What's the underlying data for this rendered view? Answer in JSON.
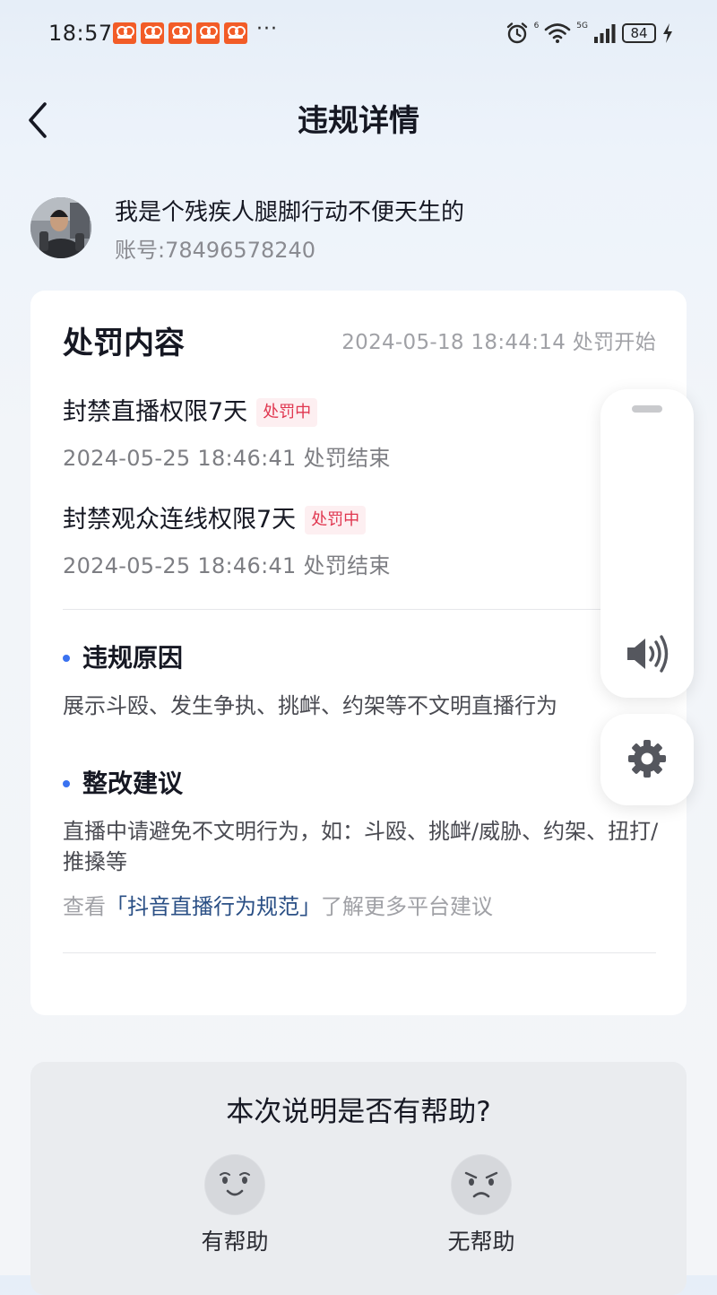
{
  "status_bar": {
    "time": "18:57",
    "more": "···",
    "battery_level": "84",
    "network": "5G",
    "signal_tag": "6"
  },
  "header": {
    "title": "违规详情"
  },
  "user": {
    "name": "我是个残疾人腿脚行动不便天生的",
    "account": "账号:78496578240"
  },
  "penalty": {
    "title": "处罚内容",
    "start": "2024-05-18 18:44:14 处罚开始",
    "items": [
      {
        "name": "封禁直播权限7天",
        "badge": "处罚中",
        "end": "2024-05-25 18:46:41 处罚结束"
      },
      {
        "name": "封禁观众连线权限7天",
        "badge": "处罚中",
        "end": "2024-05-25 18:46:41 处罚结束"
      }
    ],
    "reason_title": "违规原因",
    "reason_text": "展示斗殴、发生争执、挑衅、约架等不文明直播行为",
    "advice_title": "整改建议",
    "advice_text": "直播中请避免不文明行为，如：斗殴、挑衅/威胁、约架、扭打/推搡等",
    "more_prefix": "查看",
    "more_link": "「抖音直播行为规范」",
    "more_suffix": "了解更多平台建议"
  },
  "feedback": {
    "question": "本次说明是否有帮助?",
    "helpful": "有帮助",
    "not_helpful": "无帮助"
  },
  "colors": {
    "accent_blue": "#3a72f0",
    "badge_red": "#e0364f",
    "notification_orange": "#f25c27",
    "link": "#2a4f85"
  },
  "icons": {
    "back": "chevron-left-icon",
    "alarm": "alarm-icon",
    "wifi": "wifi-icon",
    "signal": "signal-bars-icon",
    "charging": "lightning-icon",
    "volume": "speaker-icon",
    "settings": "gear-icon",
    "happy": "smile-face-icon",
    "unhappy": "frown-face-icon"
  }
}
